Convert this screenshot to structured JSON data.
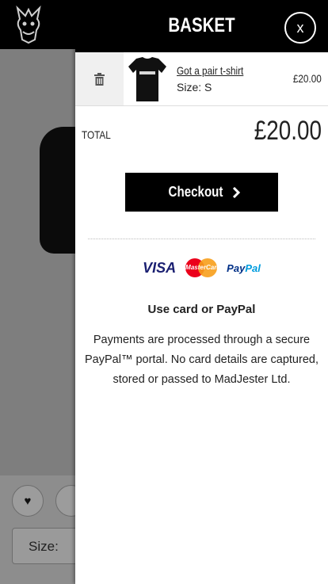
{
  "background": {
    "size_label": "Size:"
  },
  "basket": {
    "title": "BASKET",
    "close_label": "x",
    "items": [
      {
        "name": "Got a pair t-shirt",
        "size": "Size: S",
        "price": "£20.00"
      }
    ],
    "total_label": "TOTAL",
    "total_value": "£20.00",
    "checkout_label": "Checkout",
    "payment_logos": {
      "visa": "VISA",
      "mastercard": "MasterCard",
      "paypal_a": "Pay",
      "paypal_b": "Pal"
    },
    "payment_heading": "Use card or PayPal",
    "payment_text": "Payments are processed through a secure PayPal™ portal. No card details are captured, stored or passed to MadJester Ltd."
  },
  "colors": {
    "header_bg": "#000000",
    "visa_blue": "#1a1f71",
    "mc_red": "#eb001b",
    "mc_orange": "#f79e1b",
    "paypal_dark": "#003087",
    "paypal_light": "#009cde"
  },
  "icons": [
    "jester-logo-icon",
    "trash-icon",
    "chevron-right-icon",
    "heart-icon",
    "share-icon"
  ]
}
